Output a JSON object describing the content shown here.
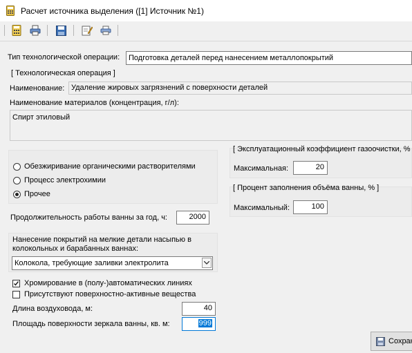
{
  "window": {
    "title": "Расчет источника выделения ([1] Источник №1)"
  },
  "toolbar": {
    "buttons": [
      {
        "icon": "calculator-icon"
      },
      {
        "icon": "print-icon"
      },
      {
        "icon": "save-icon"
      },
      {
        "icon": "edit-icon"
      },
      {
        "icon": "print-preview-icon"
      }
    ]
  },
  "operation_type": {
    "label": "Тип технологической операции:",
    "value": "Подготовка деталей перед нанесением металлопокрытий"
  },
  "tech_operation": {
    "group_title": "[ Технологическая операция ]",
    "name_label": "Наименование:",
    "name_value": "Удаление жировых загрязнений с поверхности деталей",
    "materials_label": "Наименование материалов (концентрация, г/л):",
    "materials_value": "Спирт этиловый"
  },
  "process_type": {
    "options": [
      {
        "label": "Обезжиривание органическими растворителями",
        "checked": false
      },
      {
        "label": "Процесс электрохимии",
        "checked": false
      },
      {
        "label": "Прочее",
        "checked": true
      }
    ]
  },
  "gas_cleaning": {
    "group_title": "[ Эксплуатационный коэффициент газоочистки, % ]",
    "max_label": "Максимальная:",
    "max_value": "20"
  },
  "bath_fill": {
    "group_title": "[ Процент заполнения объёма ванны, % ]",
    "max_label": "Максимальный:",
    "max_value": "100"
  },
  "bath_hours": {
    "label": "Продолжительность работы ванны за год, ч:",
    "value": "2000"
  },
  "bulk_coating": {
    "label": "Нанесение покрытий на мелкие детали насыпью в колокольных и барабанных ваннах:",
    "selected": "Колокола, требующие заливки электролита"
  },
  "checkboxes": [
    {
      "label": "Хромирование в (полу-)автоматических линиях",
      "checked": true
    },
    {
      "label": "Присутствуют поверхностно-активные вещества",
      "checked": false
    }
  ],
  "duct_length": {
    "label": "Длина воздуховода, м:",
    "value": "40"
  },
  "bath_area": {
    "label": "Площадь поверхности зеркала ванны, кв. м:",
    "value": "999"
  },
  "save_button": {
    "label": "Сохран"
  },
  "colors": {
    "selection": "#0078d7",
    "focus_border": "#0078d7"
  }
}
